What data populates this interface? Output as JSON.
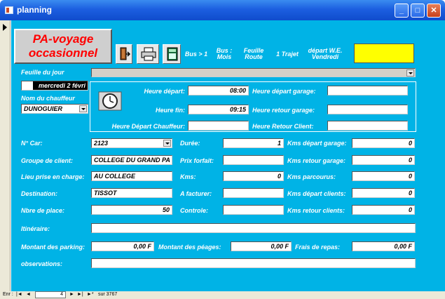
{
  "window": {
    "title": "planning"
  },
  "header": {
    "title": "PA-voyage occasionnel"
  },
  "toolbar": {
    "nav_buttons": [
      {
        "label": "Bus > 1"
      },
      {
        "label": "Bus :\nMois"
      },
      {
        "label": "Feuille\nRoute"
      },
      {
        "label": "1 Trajet"
      },
      {
        "label": "départ W.E.\nVendredi"
      }
    ]
  },
  "form": {
    "feuille_du_jour_label": "Feuille du jour",
    "date_value": "mercredi 2 févri",
    "nom_chauffeur_label": "Nom du chauffeur",
    "chauffeur_value": "DUNOGUIER",
    "heure_depart_label": "Heure départ:",
    "heure_depart_value": "08:00",
    "heure_fin_label": "Heure fin:",
    "heure_fin_value": "09:15",
    "heure_depart_chauffeur_label": "Heure Départ Chauffeur:",
    "heure_depart_garage_label": "Heure départ garage:",
    "heure_retour_garage_label": "Heure retour garage:",
    "heure_retour_client_label": "Heure Retour Client:",
    "no_car_label": "N° Car:",
    "no_car_value": "2123",
    "groupe_client_label": "Groupe de client:",
    "groupe_client_value": "COLLEGE DU GRAND PA",
    "lieu_prise_label": "Lieu prise en charge:",
    "lieu_prise_value": "AU COLLEGE",
    "destination_label": "Destination:",
    "destination_value": "TISSOT",
    "nbre_place_label": "Nbre de place:",
    "nbre_place_value": "50",
    "duree_label": "Durée:",
    "duree_value": "1",
    "prix_forfait_label": "Prix forfait:",
    "kms_label": "Kms:",
    "kms_value": "0",
    "a_facturer_label": "A facturer:",
    "controle_label": "Controle:",
    "kms_depart_garage_label": "Kms départ garage:",
    "kms_depart_garage_value": "0",
    "kms_retour_garage_label": "Kms retour garage:",
    "kms_retour_garage_value": "0",
    "kms_parcourus_label": "Kms parcourus:",
    "kms_parcourus_value": "0",
    "kms_depart_clients_label": "Kms départ clients:",
    "kms_depart_clients_value": "0",
    "kms_retour_clients_label": "Kms retour clients:",
    "kms_retour_clients_value": "0",
    "itineraire_label": "Itinéraire:",
    "montant_parking_label": "Montant des parking:",
    "montant_parking_value": "0,00 F",
    "montant_peages_label": "Montant des péages:",
    "montant_peages_value": "0,00 F",
    "frais_repas_label": "Frais de repas:",
    "frais_repas_value": "0,00 F",
    "observations_label": "observations:"
  },
  "statusbar": {
    "enr_label": "Enr :",
    "record_number": "4",
    "total_text": "sur  3767"
  },
  "colors": {
    "form_bg": "#00b3e6",
    "title_text": "#ff0000",
    "highlight": "#ffff00",
    "titlebar": "#1c5fe0"
  }
}
